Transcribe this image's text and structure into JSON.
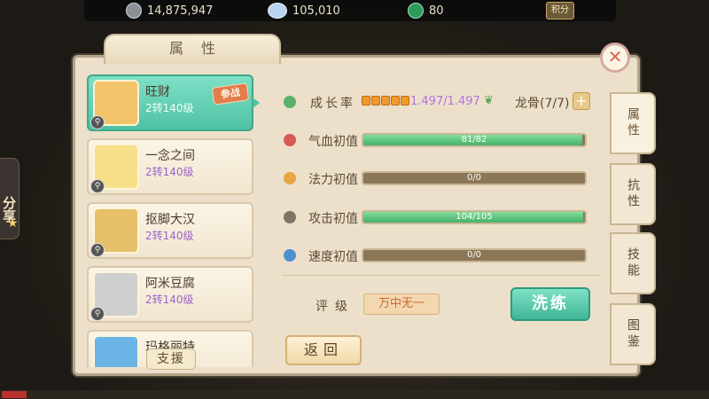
{
  "currencies": {
    "silver": "14,875,947",
    "crystal": "105,010",
    "jade": "80",
    "points_label": "积分"
  },
  "share_label": "分享",
  "panel": {
    "title": "属性",
    "close_icon": "close-icon"
  },
  "pets": [
    {
      "name": "旺财",
      "level": "2转140级",
      "badge": "参战",
      "selected": true,
      "avatar_color": "#f2c46a"
    },
    {
      "name": "一念之间",
      "level": "2转140级",
      "selected": false,
      "avatar_color": "#f7e08a"
    },
    {
      "name": "抠脚大汉",
      "level": "2转140级",
      "selected": false,
      "avatar_color": "#e8c06a"
    },
    {
      "name": "阿米豆腐",
      "level": "2转140级",
      "selected": false,
      "avatar_color": "#cfcfcf"
    },
    {
      "name": "玛格丽特",
      "level": "",
      "selected": false,
      "avatar_color": "#6bb5e6"
    }
  ],
  "support_label": "支援",
  "tabs": [
    "属性",
    "抗性",
    "技能",
    "图鉴"
  ],
  "stats": {
    "growth_label": "成长率",
    "growth_value": "1.497/1.497",
    "growth_blocks": 5,
    "bone_label": "龙骨(7/7)",
    "plus_label": "+",
    "hp_label": "气血初值",
    "hp_value": "81/82",
    "hp_fraction": 0.988,
    "mp_label": "法力初值",
    "mp_value": "0/0",
    "mp_fraction": 0,
    "atk_label": "攻击初值",
    "atk_value": "104/105",
    "atk_fraction": 0.99,
    "spd_label": "速度初值",
    "spd_value": "0/0",
    "spd_fraction": 0
  },
  "rating": {
    "label": "评级",
    "value": "万中无一"
  },
  "buttons": {
    "wash": "洗练",
    "back": "返回"
  }
}
